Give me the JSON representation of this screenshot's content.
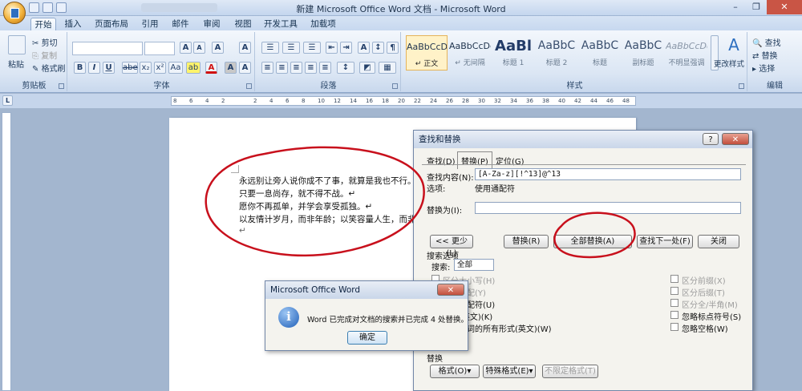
{
  "window": {
    "title": "新建 Microsoft Office Word 文档 - Microsoft Word",
    "minimize": "–",
    "restore": "❐",
    "close": "✕"
  },
  "tabs": [
    "开始",
    "插入",
    "页面布局",
    "引用",
    "邮件",
    "审阅",
    "视图",
    "开发工具",
    "加载项"
  ],
  "clipboard": {
    "paste": "粘贴",
    "cut": "剪切",
    "copy": "复制",
    "format_painter": "格式刷",
    "label": "剪贴板"
  },
  "font": {
    "label": "字体",
    "grow": "A",
    "shrink": "A",
    "clear": "A",
    "bold": "B",
    "italic": "I",
    "underline": "U",
    "strike": "abe",
    "sub": "x₂",
    "sup": "x²",
    "case": "Aa",
    "highlight": "ab",
    "color": "A",
    "char_shade": "A",
    "char_border": "A"
  },
  "paragraph": {
    "label": "段落"
  },
  "styles": {
    "label": "样式",
    "items": [
      {
        "sample": "AaBbCcDd",
        "name": "↵ 正文"
      },
      {
        "sample": "AaBbCcDd",
        "name": "↵ 无间隔"
      },
      {
        "sample": "AaBl",
        "name": "标题 1"
      },
      {
        "sample": "AaBbC",
        "name": "标题 2"
      },
      {
        "sample": "AaBbC",
        "name": "标题"
      },
      {
        "sample": "AaBbC",
        "name": "副标题"
      },
      {
        "sample": "AaBbCcDd",
        "name": "不明显强调"
      }
    ],
    "change_styles": "更改样式"
  },
  "editing": {
    "find": "查找",
    "replace": "替换",
    "select": "选择",
    "label": "编辑"
  },
  "ruler_numbers": [
    "8",
    "6",
    "4",
    "2",
    "",
    "2",
    "4",
    "6",
    "8",
    "10",
    "12",
    "14",
    "16",
    "18",
    "20",
    "22",
    "24",
    "26",
    "28",
    "30",
    "32",
    "34",
    "36",
    "38",
    "40",
    "42",
    "44",
    "46",
    "48"
  ],
  "document": {
    "lines": [
      "永远别让旁人说你成不了事，就算是我也不行。",
      "只要一息尚存，就不得不战。↵",
      "愿你不再孤单，并学会享受孤独。↵",
      "以友情计岁月，而非年龄；以笑容量人生，而非",
      "↵"
    ]
  },
  "find_replace": {
    "title": "查找和替换",
    "help": "?",
    "close": "✕",
    "tabs": [
      "查找(D)",
      "替换(P)",
      "定位(G)"
    ],
    "find_label": "查找内容(N):",
    "find_value": "[A-Za-z][!^13]@^13",
    "options_label": "选项:",
    "options_value": "使用通配符",
    "replace_label": "替换为(I):",
    "replace_value": "",
    "buttons": {
      "less": "<< 更少(L)",
      "replace": "替换(R)",
      "replace_all": "全部替换(A)",
      "find_next": "查找下一处(F)",
      "close": "关闭"
    },
    "search_options_title": "搜索选项",
    "search_label": "搜索:",
    "search_value": "全部",
    "left_options": [
      "区分大小写(H)",
      "全字匹配(Y)",
      "使用通配符(U)",
      "同音(英文)(K)",
      "查找单词的所有形式(英文)(W)"
    ],
    "right_options": [
      "区分前缀(X)",
      "区分后缀(T)",
      "区分全/半角(M)",
      "忽略标点符号(S)",
      "忽略空格(W)"
    ],
    "replace_section": "替换",
    "format_btn": "格式(O)▾",
    "special_btn": "特殊格式(E)▾",
    "no_format_btn": "不限定格式(T)"
  },
  "msgbox": {
    "title": "Microsoft Office Word",
    "message": "Word 已完成对文档的搜索并已完成 4 处替换。",
    "ok": "确定",
    "icon_glyph": "i"
  }
}
